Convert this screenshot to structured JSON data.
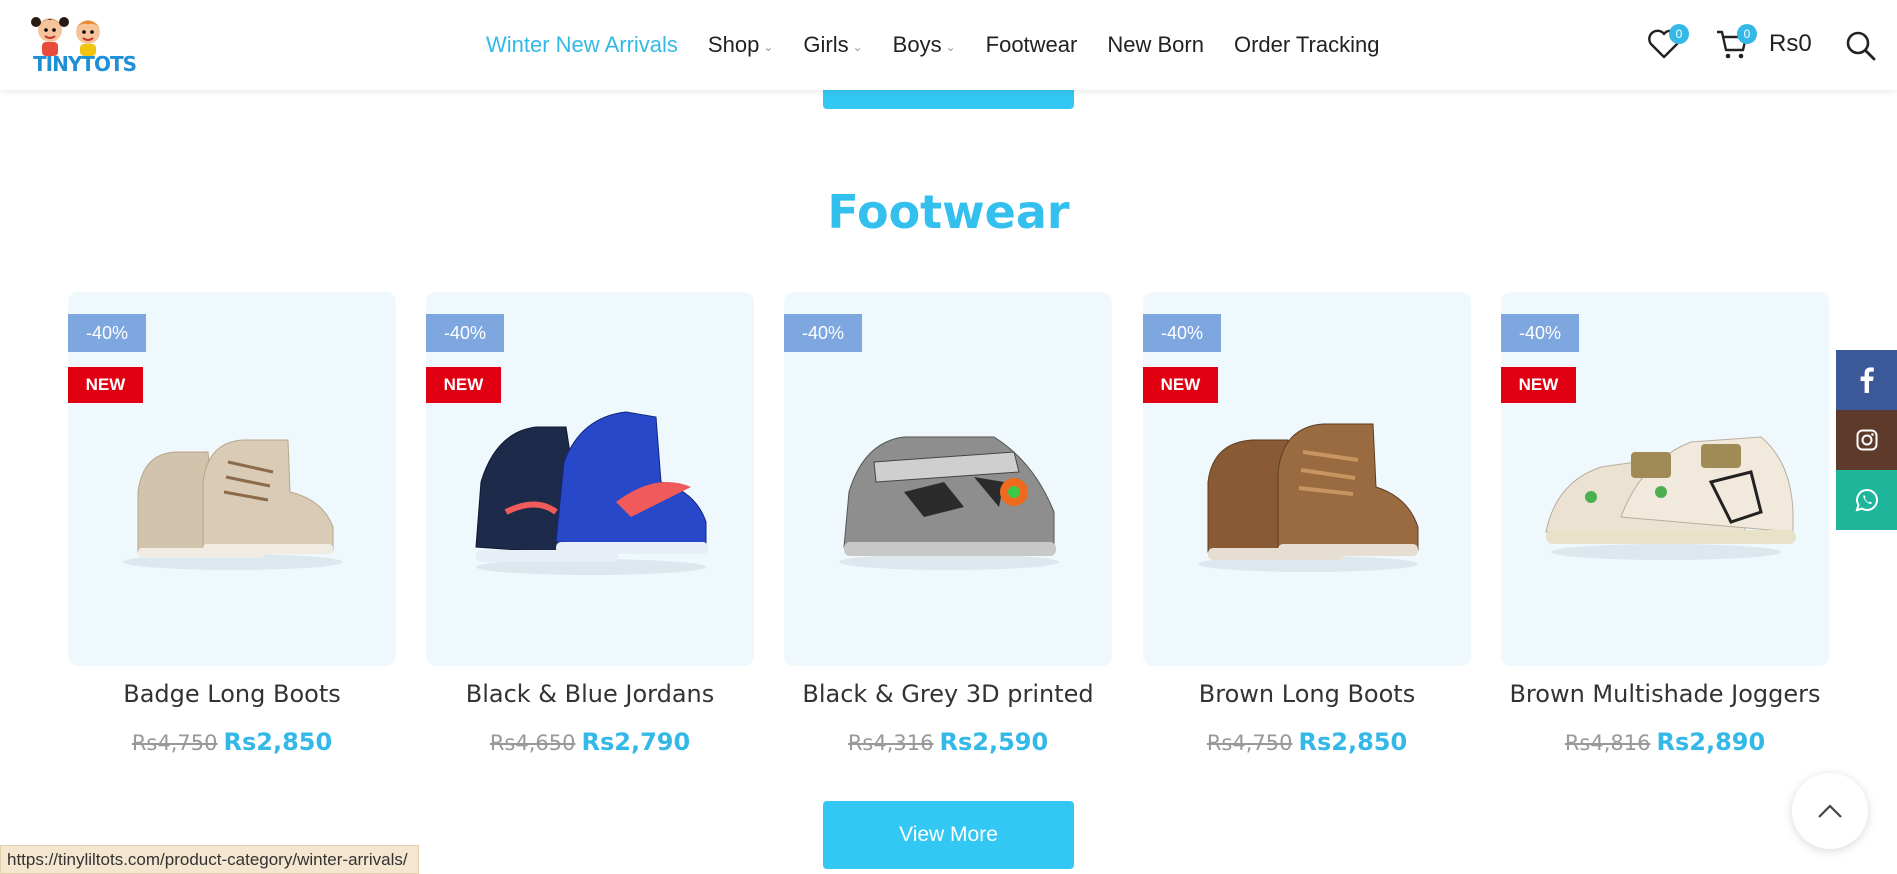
{
  "header": {
    "logo_text": "TINYTOTS",
    "nav": [
      {
        "label": "Winter New Arrivals",
        "active": true,
        "dropdown": false
      },
      {
        "label": "Shop",
        "dropdown": true
      },
      {
        "label": "Girls",
        "dropdown": true
      },
      {
        "label": "Boys",
        "dropdown": true
      },
      {
        "label": "Footwear",
        "dropdown": false
      },
      {
        "label": "New Born",
        "dropdown": false
      },
      {
        "label": "Order Tracking",
        "dropdown": false
      }
    ],
    "wishlist_count": "0",
    "cart_count": "0",
    "cart_total": "Rs0"
  },
  "section": {
    "title": "Footwear"
  },
  "products": [
    {
      "name": "Badge Long Boots",
      "discount": "-40%",
      "badge": "NEW",
      "old_price": "Rs4,750",
      "new_price": "Rs2,850",
      "color": "#d2c3ad"
    },
    {
      "name": "Black & Blue Jordans",
      "discount": "-40%",
      "badge": "NEW",
      "old_price": "Rs4,650",
      "new_price": "Rs2,790",
      "color": "#2748c9"
    },
    {
      "name": "Black & Grey 3D printed",
      "discount": "-40%",
      "badge": "",
      "old_price": "Rs4,316",
      "new_price": "Rs2,590",
      "color": "#8e8e8e"
    },
    {
      "name": "Brown Long Boots",
      "discount": "-40%",
      "badge": "NEW",
      "old_price": "Rs4,750",
      "new_price": "Rs2,850",
      "color": "#8a5a34"
    },
    {
      "name": "Brown Multishade Joggers",
      "discount": "-40%",
      "badge": "NEW",
      "old_price": "Rs4,816",
      "new_price": "Rs2,890",
      "color": "#ebe2d4"
    }
  ],
  "view_more_label": "View More",
  "status_url": "https://tinyliltots.com/product-category/winter-arrivals/",
  "colors": {
    "accent": "#33b8e8",
    "button": "#33c7f3",
    "discount_badge": "#7ea7df",
    "new_badge": "#e00012",
    "facebook": "#3b5998",
    "instagram": "#5d3a2b",
    "whatsapp": "#1fb59a"
  },
  "social": [
    {
      "icon": "facebook-icon"
    },
    {
      "icon": "instagram-icon"
    },
    {
      "icon": "whatsapp-icon"
    }
  ]
}
